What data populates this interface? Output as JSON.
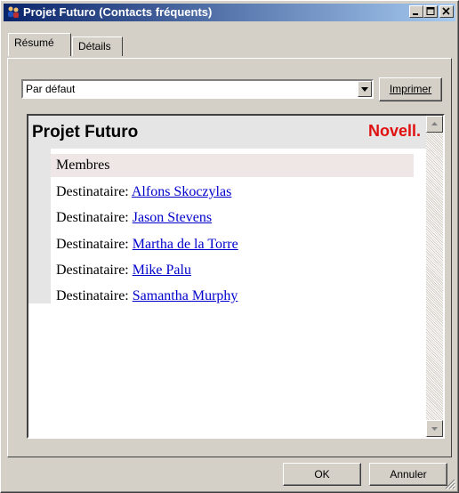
{
  "window": {
    "title": "Projet Futuro (Contacts fréquents)"
  },
  "tabs": [
    {
      "label": "Résumé",
      "active": true
    },
    {
      "label": "Détails",
      "active": false
    }
  ],
  "view_select": {
    "value": "Par défaut"
  },
  "buttons": {
    "print_label": "Imprimer",
    "ok_label": "OK",
    "cancel_label": "Annuler"
  },
  "content": {
    "title": "Projet Futuro",
    "brand": "Novell.",
    "members_header": "Membres",
    "recipient_prefix": "Destinataire:",
    "recipients": [
      "Alfons Skoczylas",
      "Jason Stevens",
      "Martha de la Torre",
      "Mike Palu",
      "Samantha Murphy"
    ]
  },
  "colors": {
    "titlebar_start": "#0a246a",
    "titlebar_end": "#a6caf0",
    "brand": "#e01010",
    "link": "#0000cc"
  }
}
